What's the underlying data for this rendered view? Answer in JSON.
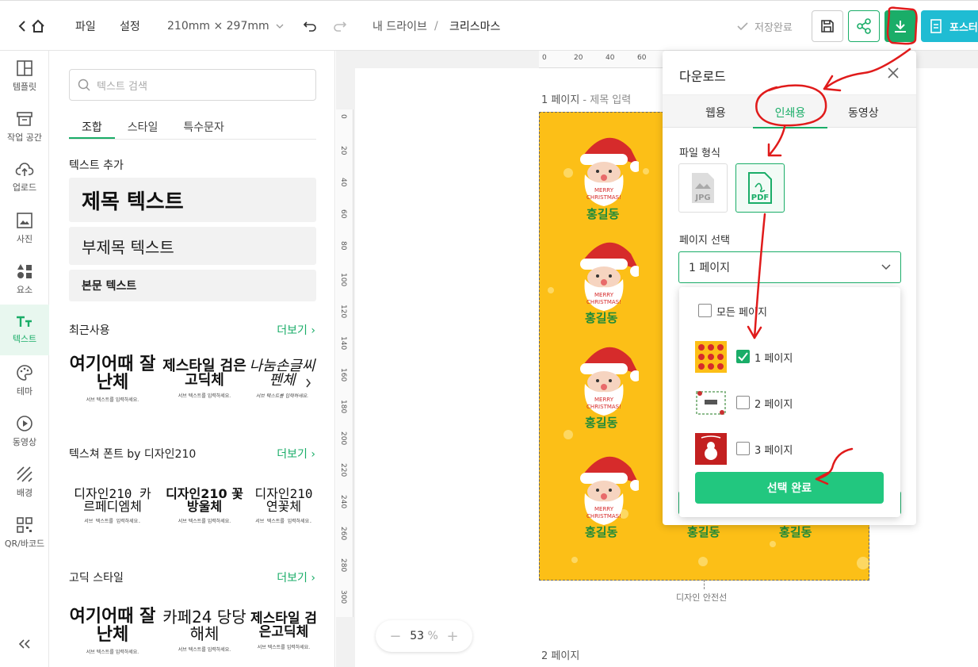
{
  "topbar": {
    "file": "파일",
    "settings": "설정",
    "page_size": "210mm × 297mm",
    "breadcrumb_root": "내 드라이브",
    "breadcrumb_sep": "/",
    "breadcrumb_current": "크리스마스",
    "save_status": "저장완료",
    "poster_button": "포스터"
  },
  "nav": {
    "items": [
      "템플릿",
      "작업 공간",
      "업로드",
      "사진",
      "요소",
      "텍스트",
      "테마",
      "동영상",
      "배경",
      "QR/바코드"
    ],
    "active": "텍스트"
  },
  "panel": {
    "search_placeholder": "텍스트 검색",
    "tabs": [
      "조합",
      "스타일",
      "특수문자"
    ],
    "add_text_title": "텍스트 추가",
    "heading_sample": "제목 텍스트",
    "subheading_sample": "부제목 텍스트",
    "body_sample": "본문 텍스트",
    "recent_title": "최근사용",
    "more": "더보기",
    "texture_title": "텍스쳐 폰트 by 디자인210",
    "gothic_title": "고딕 스타일",
    "samples": {
      "s1": "여기어때 잘난체",
      "s2": "제스타일 검은고딕체",
      "s3": "나눔손글씨 펜체",
      "t1": "디자인210 카르페디엠체",
      "t2": "디자인210 꽃방울체",
      "t3": "디자인210 연꽃체",
      "g1": "여기어때 잘난체",
      "g2": "카페24 당당해체",
      "g3": "제스타일 검은고딕체",
      "tiny": "서브 텍스트를 입력하세요."
    }
  },
  "canvas": {
    "page1_label": "1 페이지",
    "page1_title": " - 제목 입력",
    "page2_label": "2 페이지",
    "safe_line": "디자인 안전선",
    "name_text": "홍길동",
    "santa_text1": "MERRY",
    "santa_text2": "CHRISTMAS!",
    "ruler_top": [
      "0",
      "20",
      "40",
      "60"
    ],
    "ruler_left": [
      "0",
      "20",
      "40",
      "60",
      "80",
      "100",
      "120",
      "140",
      "160",
      "180",
      "200",
      "220",
      "240",
      "260",
      "280",
      "300"
    ],
    "zoom_value": "53",
    "zoom_unit": "%"
  },
  "download": {
    "title": "다운로드",
    "tabs": [
      "웹용",
      "인쇄용",
      "동영상"
    ],
    "active_tab": "인쇄용",
    "file_format_label": "파일 형식",
    "formats": [
      "JPG",
      "PDF"
    ],
    "selected_format": "PDF",
    "page_select_label": "페이지 선택",
    "page_select_value": "1 페이지",
    "all_pages": "모든 페이지",
    "pages": [
      {
        "label": "1 페이지",
        "checked": true
      },
      {
        "label": "2 페이지",
        "checked": false
      },
      {
        "label": "3 페이지",
        "checked": false
      }
    ],
    "confirm_button": "선택 완료"
  },
  "colors": {
    "accent": "#1aad68",
    "design_bg": "#fcbf17",
    "annotation": "#e01b1b"
  }
}
